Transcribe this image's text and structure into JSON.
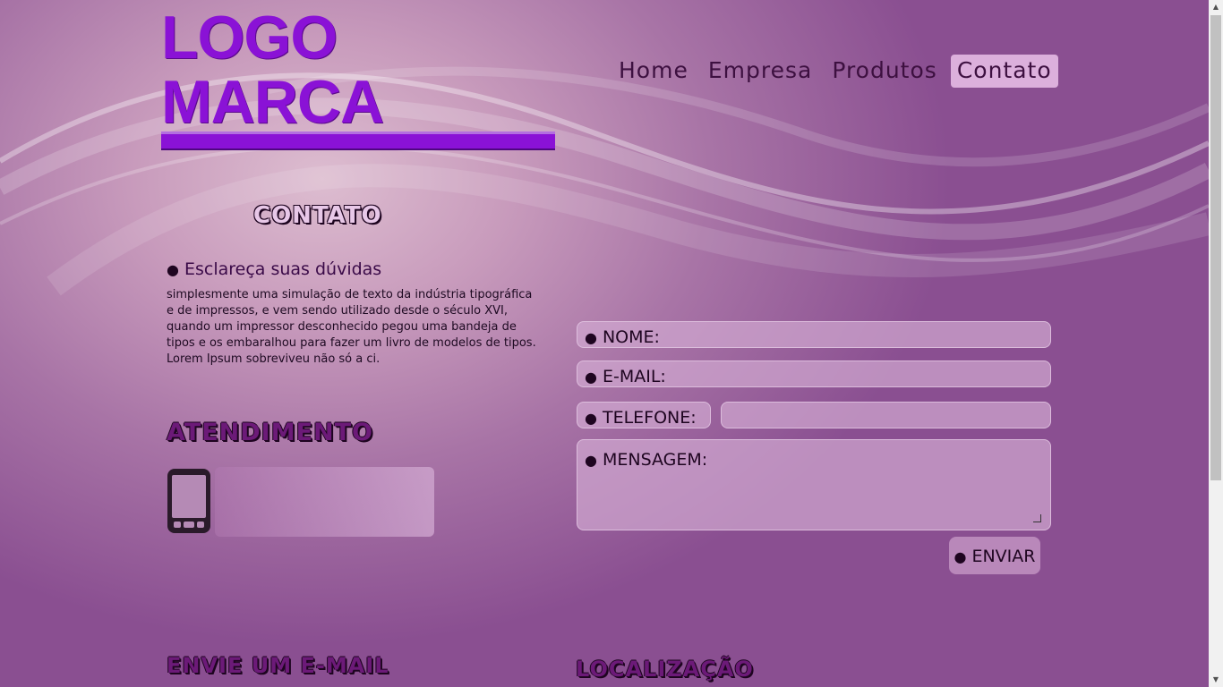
{
  "logo": {
    "text": "LOGO MARCA"
  },
  "nav": {
    "items": [
      {
        "label": "Home"
      },
      {
        "label": "Empresa"
      },
      {
        "label": "Produtos"
      },
      {
        "label": "Contato"
      }
    ],
    "active": "Contato"
  },
  "contato": {
    "title": "CONTATO",
    "subtitle": "Esclareça suas dúvidas",
    "text": "simplesmente uma simulação de texto da indústria tipográfica e de impressos, e vem sendo utilizado desde o século XVI, quando um impressor desconhecido pegou uma bandeja de tipos e os embaralhou para fazer um livro de modelos de tipos. Lorem Ipsum sobreviveu não só a ci."
  },
  "atendimento": {
    "title": "ATENDIMENTO",
    "icon": "phone-icon"
  },
  "form": {
    "nome_label": "NOME:",
    "email_label": "E-MAIL:",
    "telefone_label": "TELEFONE:",
    "mensagem_label": "MENSAGEM:",
    "enviar_label": "ENVIAR"
  },
  "sections": {
    "envie_email": "ENVIE UM E-MAIL",
    "localizacao": "LOCALIZAÇÃO"
  },
  "colors": {
    "logo": "#8a12d6",
    "nav_active_bg": "#dcb0dc",
    "heading": "#6c1a78",
    "background_dark": "#8a4f91"
  }
}
